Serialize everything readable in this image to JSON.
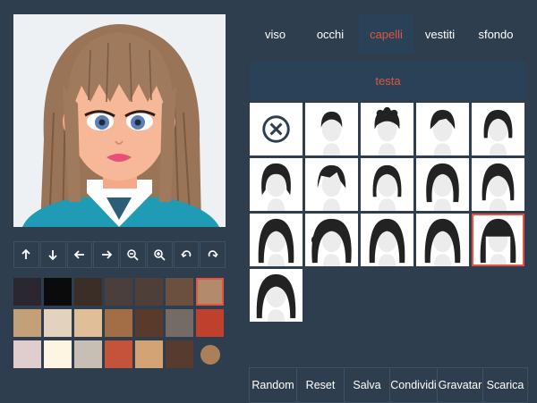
{
  "tabs": [
    {
      "label": "viso"
    },
    {
      "label": "occhi"
    },
    {
      "label": "capelli",
      "active": true
    },
    {
      "label": "vestiti"
    },
    {
      "label": "sfondo"
    }
  ],
  "section": {
    "title": "testa"
  },
  "toolbar": [
    {
      "icon": "arrow-up-icon"
    },
    {
      "icon": "arrow-down-icon"
    },
    {
      "icon": "arrow-left-icon"
    },
    {
      "icon": "arrow-right-icon"
    },
    {
      "icon": "zoom-out-icon"
    },
    {
      "icon": "zoom-in-icon"
    },
    {
      "icon": "undo-icon"
    },
    {
      "icon": "redo-icon"
    }
  ],
  "colors": {
    "accent": "#e2553f",
    "background": "#2e3e4e",
    "panel": "#2a4258"
  },
  "swatches": [
    "#2a2730",
    "#0c0b0c",
    "#3a2e27",
    "#4a3f3d",
    "#4e3f39",
    "#6b4f3f",
    "#b38b6b",
    "#c4a078",
    "#e3d3be",
    "#e0bf98",
    "#a36d45",
    "#5a3a2b",
    "#756b66",
    "#c0402e",
    "#e0cece",
    "#fdf4e1",
    "#c8bfb4",
    "#c4533a",
    "#d4a373",
    "#573b2e",
    "#ab7f5c"
  ],
  "selected_swatch": 6,
  "hair_tiles": 16,
  "selected_tile": 14,
  "actions": [
    {
      "label": "Random"
    },
    {
      "label": "Reset"
    },
    {
      "label": "Salva"
    },
    {
      "label": "Condividi"
    },
    {
      "label": "Gravatar"
    },
    {
      "label": "Scarica"
    }
  ]
}
